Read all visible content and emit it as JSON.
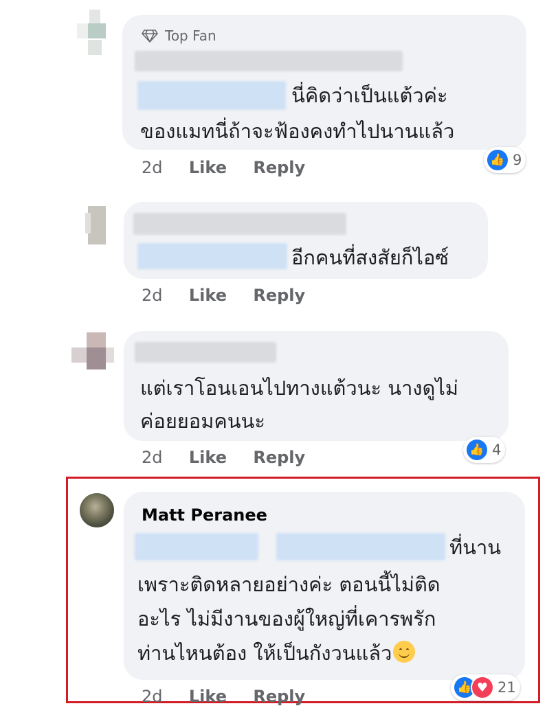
{
  "comments": [
    {
      "badge": "Top Fan",
      "text_line1": "นี่คิดว่าเป็นแต้วค่ะ",
      "text_line2": "ของแมทนี่ถ้าจะฟ้องคงทำไปนานแล้ว",
      "age": "2d",
      "like_label": "Like",
      "reply_label": "Reply",
      "reaction_count": "9"
    },
    {
      "text_line1": "อีกคนที่สงสัยก็ไอซ์",
      "age": "2d",
      "like_label": "Like",
      "reply_label": "Reply"
    },
    {
      "text_line1": "แต่เราโอนเอนไปทางแต้วนะ นางดูไม่",
      "text_line2": "ค่อยยอมคนนะ",
      "age": "2d",
      "like_label": "Like",
      "reply_label": "Reply",
      "reaction_count": "4"
    },
    {
      "author": "Matt Peranee",
      "text_line1": "ที่นาน",
      "text_line2": "เพราะติดหลายอย่างค่ะ ตอนนี้ไม่ติด",
      "text_line3": "อะไร ไม่มีงานของผู้ใหญ่ที่เคารพรัก",
      "text_line4": "ท่านไหนต้อง ให้เป็นกังวนแล้ว",
      "age": "2d",
      "like_label": "Like",
      "reply_label": "Reply",
      "reaction_count": "21"
    }
  ],
  "colors": {
    "bubble": "#f0f2f5",
    "like_blue": "#1877f2",
    "love_red": "#f33e58",
    "highlight": "#d31d26",
    "meta_text": "#65676b"
  },
  "icons": [
    "diamond-icon",
    "like-reaction-icon",
    "love-reaction-icon",
    "smile-emoji-icon"
  ]
}
